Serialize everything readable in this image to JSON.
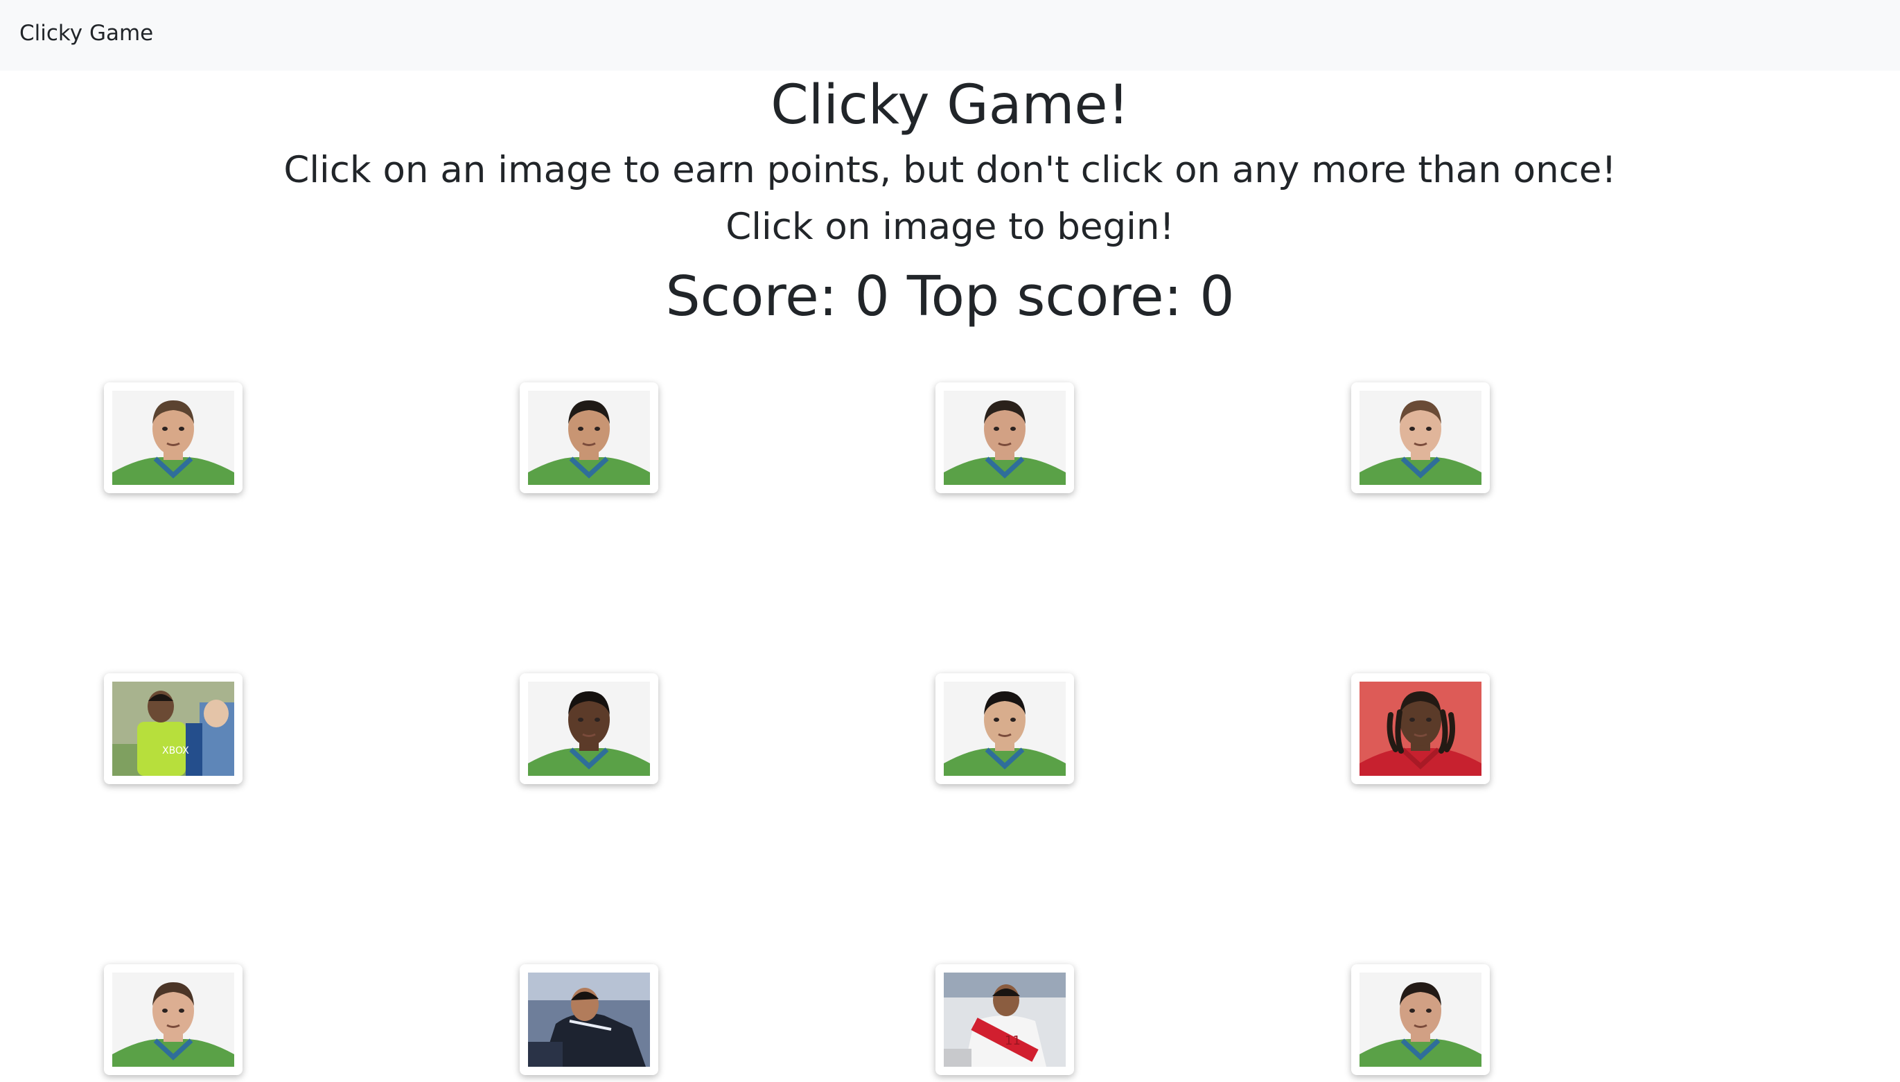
{
  "navbar": {
    "brand": "Clicky Game"
  },
  "header": {
    "title": "Clicky Game!",
    "instructions": "Click on an image to earn points, but don't click on any more than once!",
    "status": "Click on image to begin!",
    "score_label": "Score:",
    "score": "0",
    "top_score_label": "Top score:",
    "top_score": "0"
  },
  "colors": {
    "navbar_bg": "#f8f9fa",
    "text": "#212529",
    "jersey_green": "#5aa147",
    "jersey_blue": "#2f6e9a",
    "red_kit": "#d11f2f"
  },
  "cards": [
    {
      "icon": "player-portrait-icon",
      "style": "headshot",
      "jersey": "green",
      "hair": "#5b4330",
      "skin": "#d8a888"
    },
    {
      "icon": "player-portrait-icon",
      "style": "headshot",
      "jersey": "green",
      "hair": "#1f1a16",
      "skin": "#c89573"
    },
    {
      "icon": "player-portrait-icon",
      "style": "headshot",
      "jersey": "green",
      "hair": "#2a211b",
      "skin": "#d2a184"
    },
    {
      "icon": "player-portrait-icon",
      "style": "headshot",
      "jersey": "green",
      "hair": "#6a4b36",
      "skin": "#e0b59a"
    },
    {
      "icon": "player-action-photo-icon",
      "style": "action-green",
      "jersey": "green",
      "hair": "#1b1512",
      "skin": "#6b4a34"
    },
    {
      "icon": "player-portrait-icon",
      "style": "headshot",
      "jersey": "green",
      "hair": "#15110f",
      "skin": "#5c3b29"
    },
    {
      "icon": "player-portrait-icon",
      "style": "headshot",
      "jersey": "green",
      "hair": "#171312",
      "skin": "#d8ad8d"
    },
    {
      "icon": "player-portrait-icon",
      "style": "headshot-red-dreadlocks",
      "jersey": "red",
      "hair": "#231a14",
      "skin": "#5b3b29"
    },
    {
      "icon": "player-portrait-icon",
      "style": "headshot",
      "jersey": "green",
      "hair": "#4b3527",
      "skin": "#dcae92"
    },
    {
      "icon": "player-action-photo-icon",
      "style": "action-dark",
      "jersey": "black",
      "hair": "#161210",
      "skin": "#b27c5b"
    },
    {
      "icon": "player-action-photo-icon",
      "style": "action-peru",
      "jersey": "white-red",
      "hair": "#1a1512",
      "skin": "#8b5d40"
    },
    {
      "icon": "player-portrait-icon",
      "style": "headshot",
      "jersey": "green",
      "hair": "#231a16",
      "skin": "#d1a084"
    }
  ]
}
